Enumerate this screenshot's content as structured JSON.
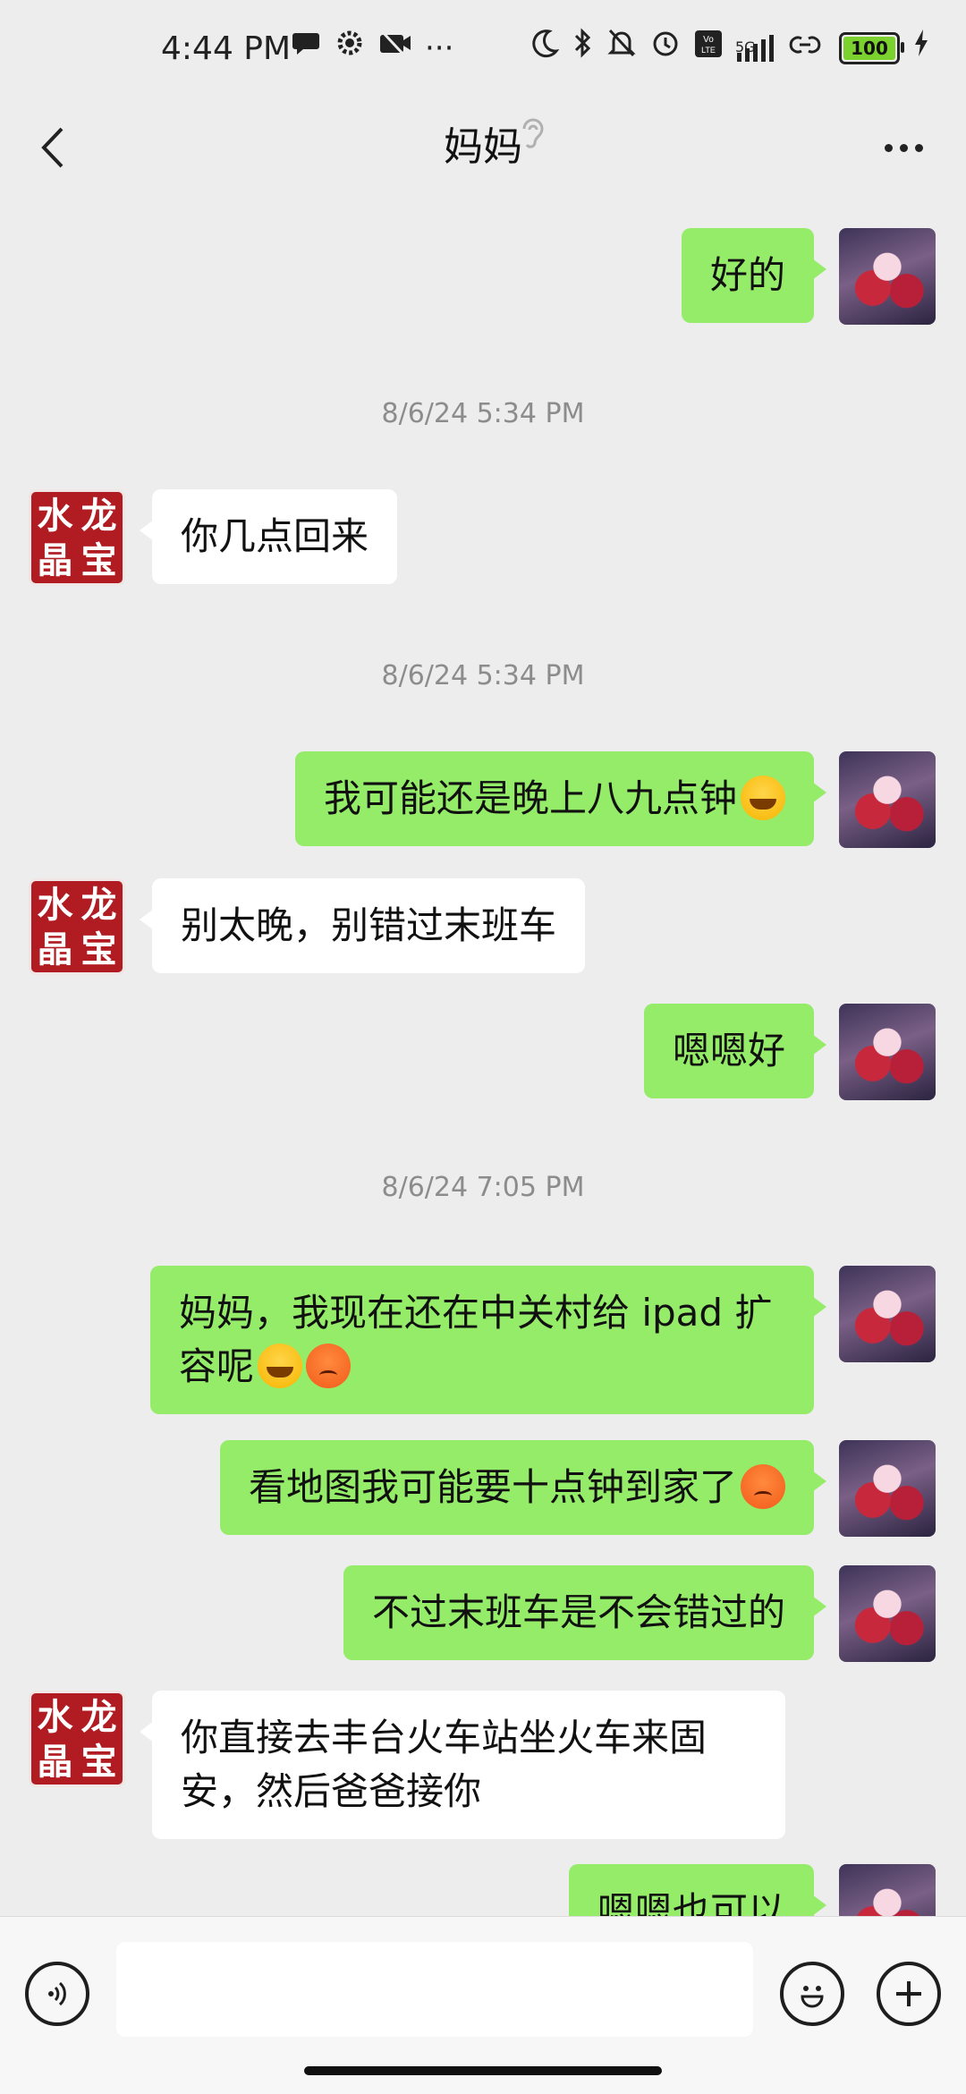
{
  "status_bar": {
    "time": "4:44 PM",
    "battery": "100",
    "network": "5G",
    "icons": [
      "chat-bubble-icon",
      "gear-icon",
      "camera-off-icon",
      "more-dots-icon",
      "moon-icon",
      "bluetooth-icon",
      "bell-off-icon",
      "alarm-icon",
      "volte-icon",
      "signal-icon",
      "link-icon",
      "battery-icon",
      "charging-icon"
    ]
  },
  "header": {
    "title": "妈妈",
    "back_icon": "back-chevron-icon",
    "ear_icon": "ear-icon",
    "more_icon": "more-dots-icon"
  },
  "messages": [
    {
      "type": "text",
      "from": "me",
      "text": "好的"
    },
    {
      "type": "timestamp",
      "text": "8/6/24 5:34 PM"
    },
    {
      "type": "text",
      "from": "mom",
      "text": "你几点回来"
    },
    {
      "type": "timestamp",
      "text": "8/6/24 5:34 PM"
    },
    {
      "type": "text",
      "from": "me",
      "text": "我可能还是晚上八九点钟",
      "emojis": [
        "laugh"
      ]
    },
    {
      "type": "text",
      "from": "mom",
      "text": "别太晚，别错过末班车"
    },
    {
      "type": "text",
      "from": "me",
      "text": "嗯嗯好"
    },
    {
      "type": "timestamp",
      "text": "8/6/24 7:05 PM"
    },
    {
      "type": "text",
      "from": "me",
      "text": "妈妈，我现在还在中关村给 ipad 扩容呢",
      "emojis": [
        "laugh",
        "angry"
      ]
    },
    {
      "type": "text",
      "from": "me",
      "text": "看地图我可能要十点钟到家了",
      "emojis": [
        "angry"
      ]
    },
    {
      "type": "text",
      "from": "me",
      "text": "不过末班车是不会错过的"
    },
    {
      "type": "text",
      "from": "mom",
      "text": "你直接去丰台火车站坐火车来固安，然后爸爸接你"
    },
    {
      "type": "text",
      "from": "me",
      "text": "嗯嗯也可以"
    }
  ],
  "mom_avatar": {
    "chars": [
      "水",
      "龙",
      "晶",
      "宝"
    ]
  },
  "input_bar": {
    "value": "",
    "placeholder": "",
    "voice_icon": "voice-icon",
    "emoji_icon": "emoji-face-icon",
    "plus_icon": "plus-icon"
  },
  "colors": {
    "background": "#ededed",
    "my_bubble": "#95ec69",
    "their_bubble": "#ffffff",
    "timestamp": "#8c8c8c"
  }
}
